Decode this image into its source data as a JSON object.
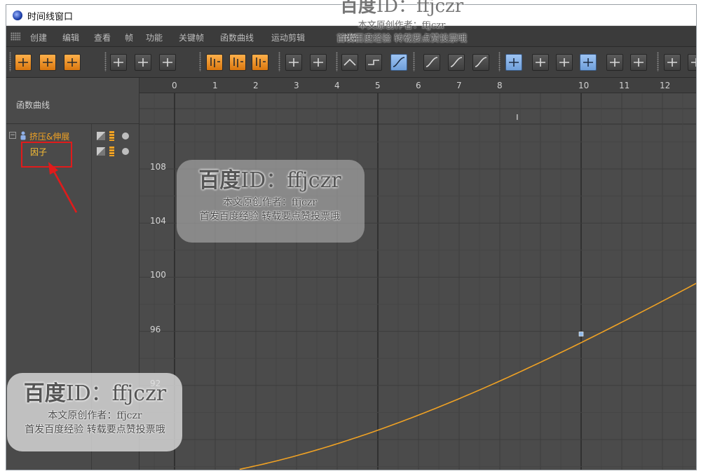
{
  "window": {
    "title": "时间线窗口"
  },
  "menu": {
    "items": [
      "创建",
      "编辑",
      "查看",
      "帧",
      "功能",
      "关键帧",
      "函数曲线",
      "运动剪辑",
      "书签"
    ]
  },
  "left_panel": {
    "title": "函数曲线",
    "tree": [
      {
        "label": "挤压&伸展",
        "expanded": true
      },
      {
        "label": "因子",
        "selected": true
      }
    ]
  },
  "timeline": {
    "frames": [
      "0",
      "1",
      "2",
      "3",
      "4",
      "5",
      "6",
      "7",
      "8",
      "10",
      "11",
      "12"
    ],
    "values": [
      "108",
      "104",
      "100",
      "96",
      "92"
    ],
    "key_frame_marker": "I"
  },
  "curve": {
    "color": "#f0a224",
    "key_color": "#8fb8e8",
    "key": {
      "frame": 10,
      "value": 95.8
    }
  },
  "watermarks": [
    {
      "title": "百度",
      "id": "ID：ffjczr",
      "line1": "本文原创作者：ffjczr",
      "line2": "首发百度经验  转载要点赞投票哦"
    },
    {
      "title": "百度",
      "id": "ID：ffjczr",
      "line1": "本文原创作者：ffjczr",
      "line2": "首发百度经验  转载要点赞投票哦"
    },
    {
      "title": "百度",
      "id": "ID：ffjczr",
      "line1": "本文原创作者：ffjczr",
      "line2": "首发百度经验  转载要点赞投票哦"
    }
  ],
  "colors": {
    "accent": "#f0a224",
    "annotation": "#e01b1b",
    "grid": "#3c3c3c"
  }
}
